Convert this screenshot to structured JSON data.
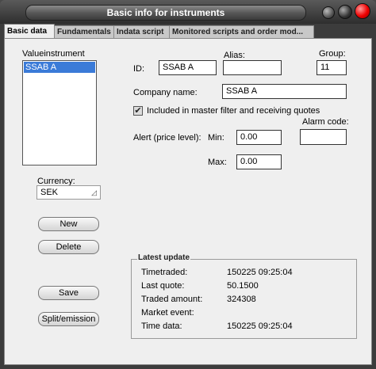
{
  "window": {
    "title": "Basic info for instruments"
  },
  "tabs": [
    {
      "label": "Basic data"
    },
    {
      "label": "Fundamentals"
    },
    {
      "label": "Indata script"
    },
    {
      "label": "Monitored scripts and order mod..."
    }
  ],
  "left": {
    "list_label": "Valueinstrument",
    "list_items": [
      "SSAB A"
    ],
    "currency_label": "Currency:",
    "currency_value": "SEK",
    "new_button": "New",
    "delete_button": "Delete",
    "save_button": "Save",
    "split_button": "Split/emission"
  },
  "form": {
    "id_label": "ID:",
    "id_value": "SSAB A",
    "alias_label": "Alias:",
    "alias_value": "",
    "group_label": "Group:",
    "group_value": "11",
    "company_label": "Company name:",
    "company_value": "SSAB A",
    "master_filter_label": "Included in master filter and receiving quotes",
    "master_filter_checked": true,
    "alert_label": "Alert (price level):",
    "min_label": "Min:",
    "min_value": "0.00",
    "max_label": "Max:",
    "max_value": "0.00",
    "alarm_code_label": "Alarm code:",
    "alarm_code_value": ""
  },
  "latest_update": {
    "title": "Latest update",
    "rows": [
      {
        "label": "Timetraded:",
        "value": "150225 09:25:04"
      },
      {
        "label": "Last quote:",
        "value": "50.1500"
      },
      {
        "label": "Traded amount:",
        "value": "324308"
      },
      {
        "label": "Market event:",
        "value": ""
      },
      {
        "label": "Time data:",
        "value": "150225 09:25:04"
      }
    ]
  }
}
